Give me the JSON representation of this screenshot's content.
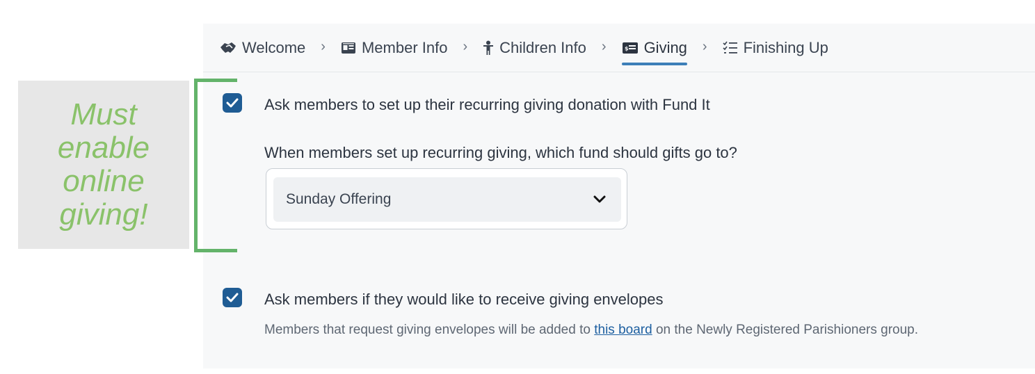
{
  "breadcrumb": {
    "items": [
      {
        "label": "Welcome",
        "icon": "handshake-icon",
        "active": false
      },
      {
        "label": "Member Info",
        "icon": "id-card-icon",
        "active": false
      },
      {
        "label": "Children Info",
        "icon": "child-icon",
        "active": false
      },
      {
        "label": "Giving",
        "icon": "money-card-icon",
        "active": true
      },
      {
        "label": "Finishing Up",
        "icon": "checklist-icon",
        "active": false
      }
    ],
    "separator": "›"
  },
  "recurring": {
    "checked": true,
    "label": "Ask members to set up their recurring giving donation with Fund It",
    "fund_question": "When members set up recurring giving, which fund should gifts go to?",
    "fund_selected": "Sunday Offering"
  },
  "envelopes": {
    "checked": true,
    "label": "Ask members if they would like to receive giving envelopes",
    "desc_before": "Members that request giving envelopes will be added to ",
    "desc_link": "this board",
    "desc_after": " on the Newly Registered Parishioners group."
  },
  "annotation": {
    "text": "Must enable online giving!"
  },
  "colors": {
    "accent": "#1f5c94",
    "tab_underline": "#3d7fb8",
    "annotation_text": "#8ac26a",
    "bracket": "#63b36a"
  }
}
